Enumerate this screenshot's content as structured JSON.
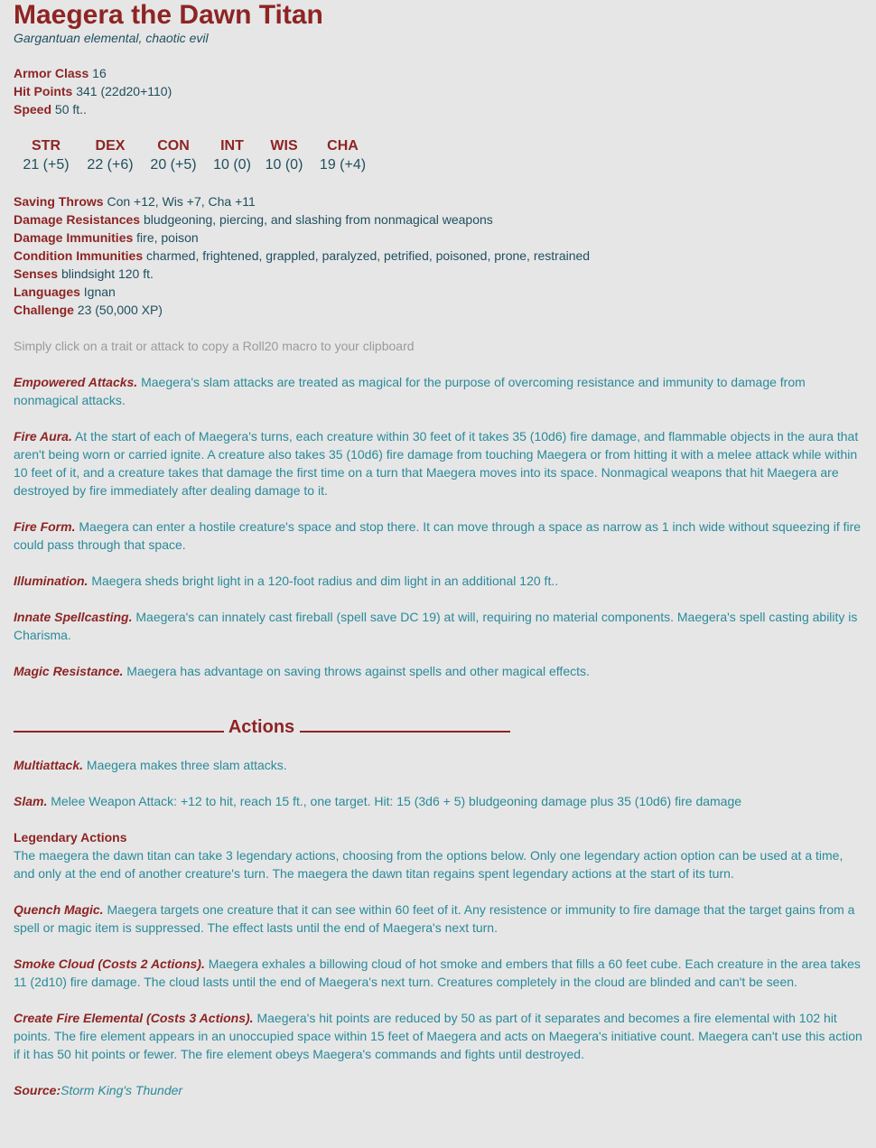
{
  "title": "Maegera the Dawn Titan",
  "subtitle": "Gargantuan elemental, chaotic evil",
  "basic": [
    {
      "label": "Armor Class",
      "value": "16"
    },
    {
      "label": "Hit Points",
      "value": "341 (22d20+110)"
    },
    {
      "label": "Speed",
      "value": "50 ft.."
    }
  ],
  "abilities": [
    {
      "name": "STR",
      "value": "21 (+5)"
    },
    {
      "name": "DEX",
      "value": "22 (+6)"
    },
    {
      "name": "CON",
      "value": "20 (+5)"
    },
    {
      "name": "INT",
      "value": "10 (0)"
    },
    {
      "name": "WIS",
      "value": "10 (0)"
    },
    {
      "name": "CHA",
      "value": "19 (+4)"
    }
  ],
  "details": [
    {
      "label": "Saving Throws",
      "value": "Con +12, Wis +7, Cha +11"
    },
    {
      "label": "Damage Resistances",
      "value": "bludgeoning, piercing, and slashing from nonmagical weapons"
    },
    {
      "label": "Damage Immunities",
      "value": "fire, poison"
    },
    {
      "label": "Condition Immunities",
      "value": "charmed, frightened, grappled, paralyzed, petrified, poisoned, prone, restrained"
    },
    {
      "label": "Senses",
      "value": "blindsight 120 ft."
    },
    {
      "label": "Languages",
      "value": "Ignan"
    },
    {
      "label": "Challenge",
      "value": "23 (50,000 XP)"
    }
  ],
  "hint": "Simply click on a trait or attack to copy a Roll20 macro to your clipboard",
  "traits": [
    {
      "name": "Empowered Attacks.",
      "text": "Maegera's slam attacks are treated as magical for the purpose of overcoming resistance and immunity to damage from nonmagical attacks."
    },
    {
      "name": "Fire Aura.",
      "text": "At the start of each of Maegera's turns, each creature within 30 feet of it takes 35 (10d6) fire damage, and flammable objects in the aura that aren't being worn or carried ignite. A creature also takes 35 (10d6) fire damage from touching Maegera or from hitting it with a melee attack while within 10 feet of it, and a creature takes that damage the first time on a turn that Maegera moves into its space. Nonmagical weapons that hit Maegera are destroyed by fire immediately after dealing damage to it."
    },
    {
      "name": "Fire Form.",
      "text": "Maegera can enter a hostile creature's space and stop there. It can move through a space as narrow as 1 inch wide without squeezing if fire could pass through that space."
    },
    {
      "name": "Illumination.",
      "text": "Maegera sheds bright light in a 120-foot radius and dim light in an additional 120 ft.."
    },
    {
      "name": "Innate Spellcasting.",
      "text": "Maegera's can innately cast fireball (spell save DC 19) at will, requiring no material components. Maegera's spell casting ability is Charisma."
    },
    {
      "name": "Magic Resistance.",
      "text": "Maegera has advantage on saving throws against spells and other magical effects."
    }
  ],
  "actions_heading": "Actions",
  "actions": [
    {
      "name": "Multiattack.",
      "text": "Maegera makes three slam attacks."
    },
    {
      "name": "Slam.",
      "text": "Melee Weapon Attack: +12 to hit, reach 15 ft., one target. Hit: 15 (3d6 + 5) bludgeoning damage plus 35 (10d6) fire damage"
    }
  ],
  "legendary": {
    "title": "Legendary Actions",
    "intro": "The maegera the dawn titan can take 3 legendary actions, choosing from the options below. Only one legendary action option can be used at a time, and only at the end of another creature's turn. The maegera the dawn titan regains spent legendary actions at the start of its turn.",
    "items": [
      {
        "name": "Quench Magic.",
        "text": "Maegera targets one creature that it can see within 60 feet of it. Any resistence or immunity to fire damage that the target gains from a spell or magic item is suppressed. The effect lasts until the end of Maegera's next turn."
      },
      {
        "name": "Smoke Cloud (Costs 2 Actions).",
        "text": "Maegera exhales a billowing cloud of hot smoke and embers that fills a 60 feet cube. Each creature in the area takes 11 (2d10) fire damage. The cloud lasts until the end of Maegera's next turn. Creatures completely in the cloud are blinded and can't be seen."
      },
      {
        "name": "Create Fire Elemental (Costs 3 Actions).",
        "text": "Maegera's hit points are reduced by 50 as part of it separates and becomes a fire elemental with 102 hit points. The fire element appears in an unoccupied space within 15 feet of Maegera and acts on Maegera's initiative count. Maegera can't use this action if it has 50 hit points or fewer. The fire element obeys Maegera's commands and fights until destroyed."
      }
    ]
  },
  "source": {
    "label": "Source:",
    "value": "Storm King's Thunder"
  }
}
